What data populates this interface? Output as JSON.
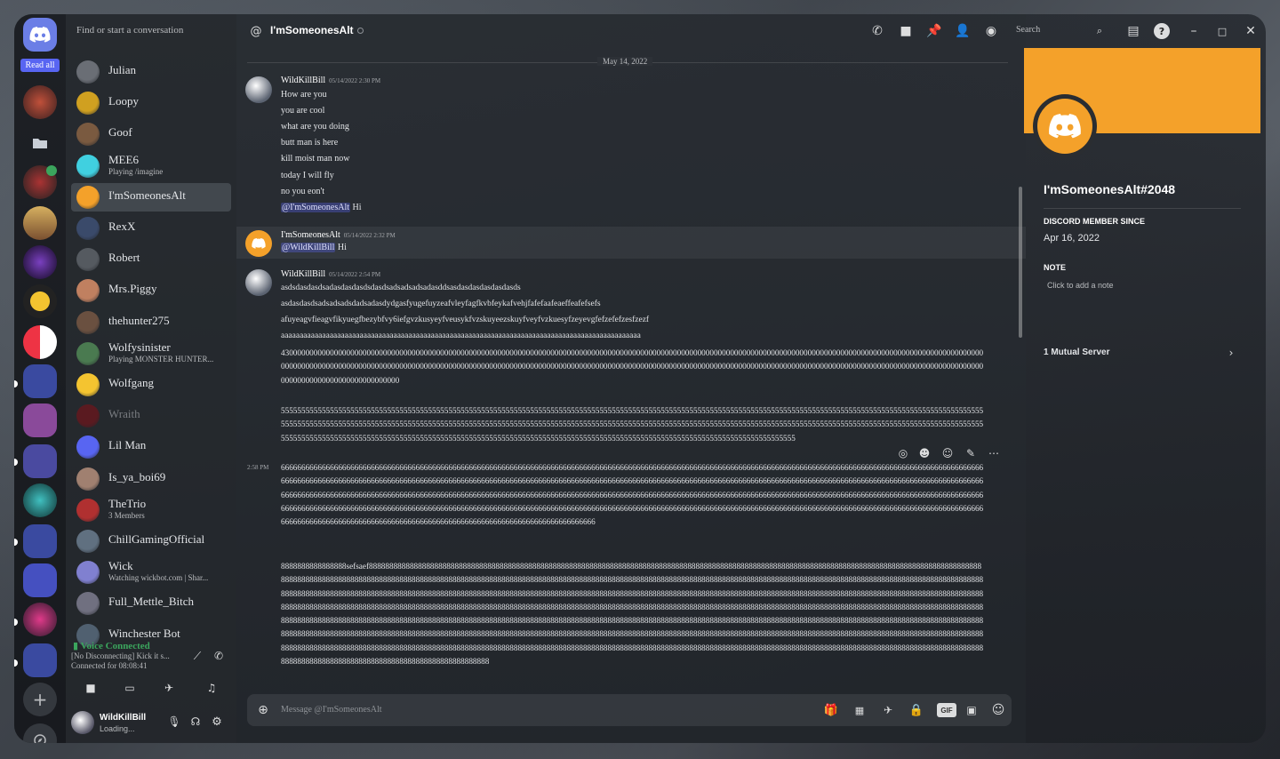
{
  "colors": {
    "accent": "#5865f2",
    "banner": "#f4a12a",
    "voice": "#3ba55d"
  },
  "rail": {
    "read_all": "Read all",
    "add_icon": "plus-icon",
    "explore_icon": "compass-icon"
  },
  "dm_search": {
    "placeholder": "Find or start a conversation"
  },
  "dms": [
    {
      "name": "Julian"
    },
    {
      "name": "Loopy"
    },
    {
      "name": "Goof"
    },
    {
      "name": "MEE6",
      "sub": "Playing /imagine"
    },
    {
      "name": "I'mSomeonesAlt"
    },
    {
      "name": "RexX"
    },
    {
      "name": "Robert"
    },
    {
      "name": "Mrs.Piggy"
    },
    {
      "name": "thehunter275"
    },
    {
      "name": "Wolfysinister",
      "sub": "Playing MONSTER HUNTER..."
    },
    {
      "name": "Wolfgang"
    },
    {
      "name": "Wraith"
    },
    {
      "name": "Lil Man"
    },
    {
      "name": "Is_ya_boi69"
    },
    {
      "name": "TheTrio",
      "sub": "3 Members"
    },
    {
      "name": "ChillGamingOfficial"
    },
    {
      "name": "Wick",
      "sub": "Watching wickbot.com | Shar..."
    },
    {
      "name": "Full_Mettle_Bitch"
    },
    {
      "name": "Winchester Bot"
    }
  ],
  "voice": {
    "status": "Voice Connected",
    "channel": "[No Disconnecting] Kick it s...",
    "connected_for": "Connected for 08:08:41"
  },
  "user": {
    "name": "WildKillBill",
    "status": "Loading..."
  },
  "header": {
    "title": "I'mSomeonesAlt",
    "search": "Search"
  },
  "date_separator": "May 14, 2022",
  "messages": {
    "m1": {
      "author": "WildKillBill",
      "time": "05/14/2022 2:30 PM",
      "lines": [
        "How are you",
        "you are cool",
        "what are you doing",
        "butt man is here",
        "kill moist man now",
        "today I will fly",
        "no you eon't"
      ],
      "mention": "@I'mSomeonesAlt",
      "after": " Hi"
    },
    "m2": {
      "author": "I'mSomeonesAlt",
      "time": "05/14/2022 2:32 PM",
      "mention": "@WildKillBill",
      "after": " Hi"
    },
    "m3": {
      "author": "WildKillBill",
      "time": "05/14/2022 2:54 PM",
      "l1": "asdsdasdasdsadasdasdasdsdasdsadsadsadsadasddsasdasdasdasdasdasds",
      "l2": "asdasdasdsadsadsadsdadsadasdydgasfyugefuyzeafvleyfagfkvbfeykafvehjfafefaafeaeffeafefsefs",
      "l3": "afuyeagvfieagvfikyuegfbezybfvy6iefgvzkusyeyfveusykfvzskuyeezskuyfveyfvzkuesyfzeyevgfefzefefzesfzezf",
      "l4": "aaaaaaaaaaaaaaaaaaaaaaaaaaaaaaaaaaaaaaaaaaaaaaaaaaaaaaaaaaaaaaaaaaaaaaaaaaaaaaaaaaaaaaaaaaaaaaaa",
      "zeros": "4300000000000000000000000000000000000000000000000000000000000000000000000000000000000000000000000000000000000000000000000000000000000000000000000000000000000000000000000000000000000000000000000000000000000000000000000000000000000000000000000000000000000000000000000000000000000000000000000000000000000000000000000000000000000000000000000000000000000000000000000000000000000",
      "fives": "55555555555555555555555555555555555555555555555555555555555555555555555555555555555555555555555555555555555555555555555555555555555555555555555555555555555555555555555555555555555555555555555555555555555555555555555555555555555555555555555555555555555555555555555555555555555555555555555555555555555555555555555555555555555555555555555555555555555555555555555555555555555555555555555555555555555555555555555555555555555555555555555555555555555555555555555555555555555555",
      "time2": "2:58 PM",
      "sixes": "666666666666666666666666666666666666666666666666666666666666666666666666666666666666666666666666666666666666666666666666666666666666666666666666666666666666666666666666666666666666666666666666666666666666666666666666666666666666666666666666666666666666666666666666666666666666666666666666666666666666666666666666666666666666666666666666666666666666666666666666666666666666666666666666666666666666666666666666666666666666666666666666666666666666666666666666666666666666666666666666666666666666666666666666666666666666666666666666666666666666666666666666666666666666666666666666666666666666666666666666666666666666666666666666666666666666666666666666666666666666666666666666666666666666666666666666666666666666666666666666666666666666666666666666666666666666666666666",
      "eights": "8888888888888888sefsaef888888888888888888888888888888888888888888888888888888888888888888888888888888888888888888888888888888888888888888888888888888888888888888888888888888888888888888888888888888888888888888888888888888888888888888888888888888888888888888888888888888888888888888888888888888888888888888888888888888888888888888888888888888888888888888888888888888888888888888888888888888888888888888888888888888888888888888888888888888888888888888888888888888888888888888888888888888888888888888888888888888888888888888888888888888888888888888888888888888888888888888888888888888888888888888888888888888888888888888888888888888888888888888888888888888888888888888888888888888888888888888888888888888888888888888888888888888888888888888888888888888888888888888888888888888888888888888888888888888888888888888888888888888888888888888888888888888888888888888888888888888888888888888888888888888888888888888888888888888888888888888888888888888888888888888888888888888888888888888888888888888888888888888888888888888888888888888888888888888888888888888888888888888888888888888888888888888888888888888888888888888888888888888888888888888888888888888888888888888888888888888888888888888888888888888888888888888888888888888888888888888888888888888888888888888888"
    }
  },
  "composer": {
    "placeholder": "Message @I'mSomeonesAlt"
  },
  "profile": {
    "name": "I'mSomeonesAlt#2048",
    "member_since_label": "DISCORD MEMBER SINCE",
    "member_since": "Apr 16, 2022",
    "note_label": "NOTE",
    "note_placeholder": "Click to add a note",
    "mutual": "1 Mutual Server"
  }
}
